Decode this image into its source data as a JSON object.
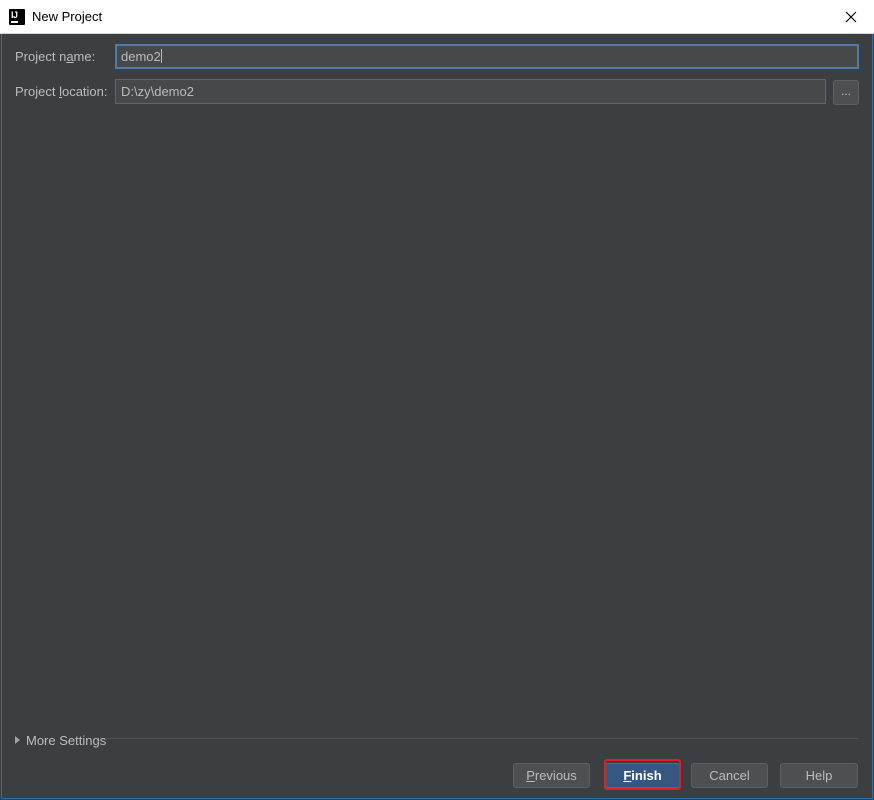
{
  "window": {
    "title": "New Project",
    "icon": "intellij-idea-icon"
  },
  "form": {
    "project_name": {
      "label_pre": "Project n",
      "label_mnemonic": "a",
      "label_post": "me:",
      "value": "demo2"
    },
    "project_location": {
      "label_pre": "Project ",
      "label_mnemonic": "l",
      "label_post": "ocation:",
      "value": "D:\\zy\\demo2",
      "browse_label": "..."
    }
  },
  "more_settings": {
    "label_pre": "More Settin",
    "label_mnemonic": "g",
    "label_post": "s"
  },
  "buttons": {
    "previous": {
      "mnemonic": "P",
      "rest": "revious"
    },
    "finish": {
      "mnemonic": "F",
      "rest": "inish"
    },
    "cancel": "Cancel",
    "help": "Help"
  },
  "colors": {
    "background": "#3c3f41",
    "accent": "#365880",
    "highlight": "#e02020"
  }
}
